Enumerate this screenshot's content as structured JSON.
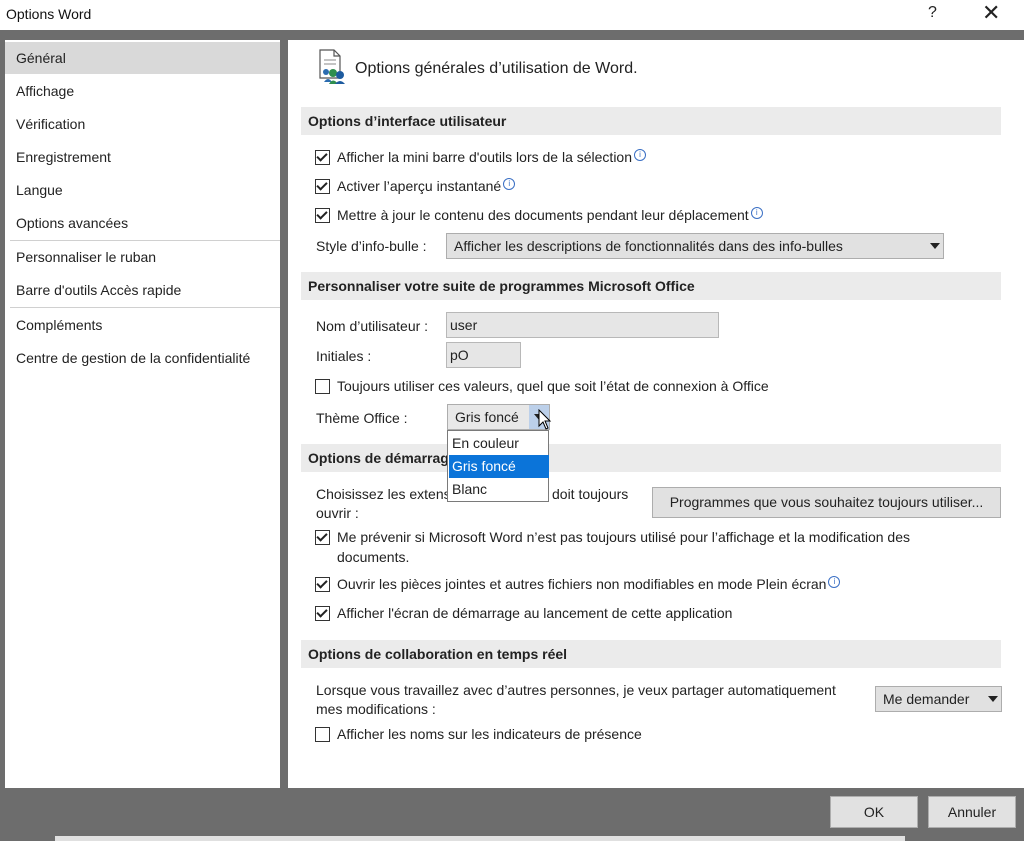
{
  "window": {
    "title": "Options Word",
    "help": "?",
    "close": "✕"
  },
  "nav": {
    "items": [
      "Général",
      "Affichage",
      "Vérification",
      "Enregistrement",
      "Langue",
      "Options avancées",
      "Personnaliser le ruban",
      "Barre d'outils Accès rapide",
      "Compléments",
      "Centre de gestion de la confidentialité"
    ],
    "selected": "Général"
  },
  "header": {
    "title": "Options générales d’utilisation de Word.",
    "icon": "general-options-icon"
  },
  "ui_section": {
    "title": "Options d’interface utilisateur",
    "mini_toolbar": "Afficher la mini barre d'outils lors de la sélection",
    "live_preview": "Activer l’aperçu instantané",
    "update_content": "Mettre à jour le contenu des documents pendant leur déplacement",
    "tooltip_label": "Style d’info-bulle :",
    "tooltip_value": "Afficher les descriptions de fonctionnalités dans des info-bulles"
  },
  "personalize_section": {
    "title": "Personnaliser votre suite de programmes Microsoft Office",
    "username_label": "Nom d’utilisateur :",
    "username_value": "user",
    "initials_label": "Initiales :",
    "initials_value": "pO",
    "always_use": "Toujours utiliser ces valeurs, quel que soit l’état de connexion à Office",
    "theme_label": "Thème Office :",
    "theme_value": "Gris foncé",
    "theme_options": [
      "En couleur",
      "Gris foncé",
      "Blanc"
    ]
  },
  "startup_section": {
    "title": "Options de démarrage",
    "choose_text_1": "Choisissez les extens",
    "choose_text_2": "doit toujours",
    "choose_text_3": "ouvrir :",
    "programs_button": "Programmes que vous souhaitez toujours utiliser...",
    "warn_line1": "Me prévenir si Microsoft Word n’est pas toujours utilisé pour l’affichage et la modification des",
    "warn_line2": "documents.",
    "open_attachments": "Ouvrir les pièces jointes et autres fichiers non modifiables en mode Plein écran",
    "show_start": "Afficher l'écran de démarrage au lancement de cette application"
  },
  "collab_section": {
    "title": "Options de collaboration en temps réel",
    "share_line1": "Lorsque vous travaillez avec d’autres personnes, je veux partager automatiquement",
    "share_line2": "mes modifications :",
    "share_value": "Me demander",
    "show_names": "Afficher les noms sur les indicateurs de présence"
  },
  "footer": {
    "ok": "OK",
    "cancel": "Annuler"
  },
  "colors": {
    "selection_blue": "#0b74d9",
    "nav_selected": "#d9d9d9",
    "frame": "#6d6d6d"
  }
}
